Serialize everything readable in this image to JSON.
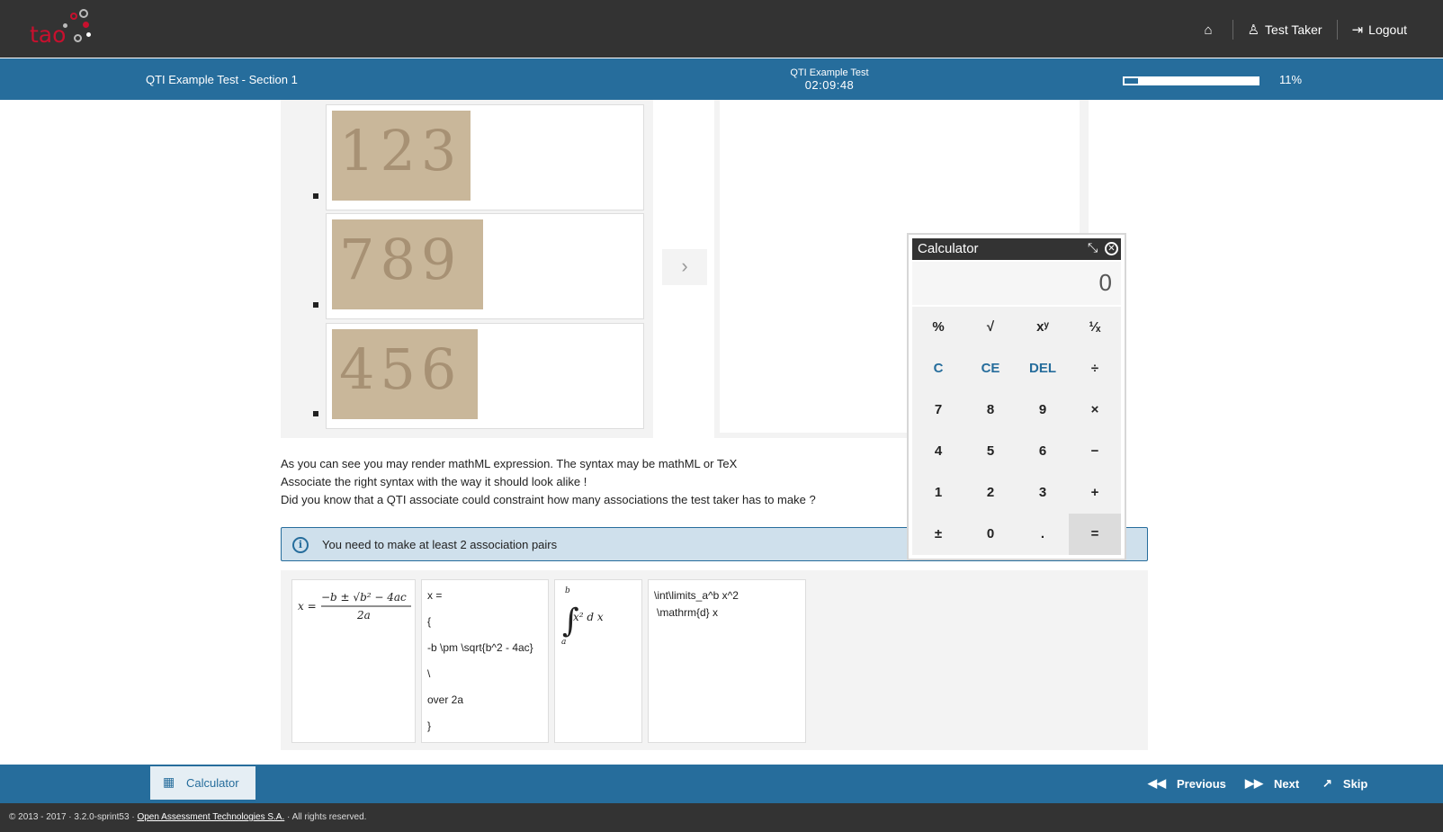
{
  "header": {
    "logo_text": "tao",
    "nav": [
      {
        "label": "",
        "icon": "home-icon"
      },
      {
        "label": "Test Taker",
        "icon": "user-icon"
      },
      {
        "label": "Logout",
        "icon": "logout-icon"
      }
    ]
  },
  "testbar": {
    "section": "QTI Example Test - Section 1",
    "test_title": "QTI Example Test",
    "timer": "02:09:48",
    "progress_percent": 11,
    "progress_label": "11%"
  },
  "order_items": [
    {
      "digits": "123"
    },
    {
      "digits": "789"
    },
    {
      "digits": "456"
    }
  ],
  "arrow": "›",
  "prompt": {
    "lines": [
      "As you can see you may render mathML expression. The syntax may be mathML or TeX",
      "Associate the right syntax with the way it should look alike !",
      "Did you know that a QTI associate could constraint how many associations the test taker has to make ?"
    ]
  },
  "info": {
    "message": "You need to make at least 2 association pairs"
  },
  "choices": {
    "quad_tex": [
      "x =",
      "{",
      "-b \\pm \\sqrt{b^2 - 4ac}",
      "\\",
      "over 2a",
      "}"
    ],
    "int_tex": [
      "\\int\\limits_a^b x^2",
      "\\mathrm{d} x"
    ],
    "quad_render": {
      "lhs": "x =",
      "num": "−b ± √b² − 4ac",
      "den": "2a"
    },
    "int_render": {
      "upper": "b",
      "lower": "a",
      "body": "x² d x"
    }
  },
  "calculator": {
    "title": "Calculator",
    "display": "0",
    "keys": [
      [
        "%",
        "√",
        "xʸ",
        "¹⁄ₓ"
      ],
      [
        "C",
        "CE",
        "DEL",
        "÷"
      ],
      [
        "7",
        "8",
        "9",
        "×"
      ],
      [
        "4",
        "5",
        "6",
        "−"
      ],
      [
        "1",
        "2",
        "3",
        "+"
      ],
      [
        "±",
        "0",
        ".",
        "="
      ]
    ]
  },
  "footer": {
    "calculator_label": "Calculator",
    "previous_label": "Previous",
    "next_label": "Next",
    "skip_label": "Skip",
    "copyright_pre": "© 2013 - 2017 · 3.2.0-sprint53 · ",
    "copyright_link": "Open Assessment Technologies S.A.",
    "copyright_post": " · All rights reserved."
  }
}
